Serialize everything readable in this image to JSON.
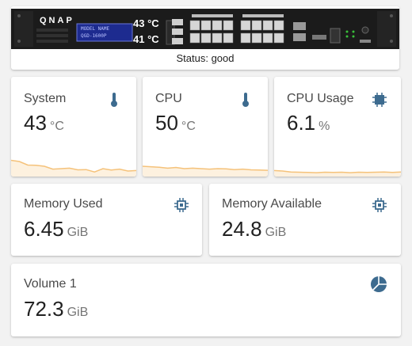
{
  "device": {
    "brand": "QNAP",
    "model_line1": "MODEL NAME",
    "model_line2": "QGD-1600P",
    "temp1": "43 °C",
    "temp2": "41 °C",
    "status": "Status: good"
  },
  "cards": {
    "system": {
      "title": "System",
      "value": "43",
      "unit": "°C",
      "icon": "thermometer-icon",
      "spark": [
        0.55,
        0.5,
        0.35,
        0.34,
        0.3,
        0.18,
        0.2,
        0.22,
        0.15,
        0.16,
        0.06,
        0.2,
        0.14,
        0.18,
        0.1,
        0.12
      ]
    },
    "cpu": {
      "title": "CPU",
      "value": "50",
      "unit": "°C",
      "icon": "thermometer-icon",
      "spark": [
        0.3,
        0.28,
        0.26,
        0.22,
        0.25,
        0.2,
        0.22,
        0.2,
        0.18,
        0.2,
        0.19,
        0.16,
        0.18,
        0.15,
        0.14,
        0.13
      ]
    },
    "cpu_usage": {
      "title": "CPU Usage",
      "value": "6.1",
      "unit": "%",
      "icon": "chip-icon",
      "spark": [
        0.12,
        0.1,
        0.06,
        0.05,
        0.04,
        0.03,
        0.05,
        0.04,
        0.05,
        0.03,
        0.05,
        0.04,
        0.05,
        0.06,
        0.04,
        0.06
      ]
    },
    "memory_used": {
      "title": "Memory Used",
      "value": "6.45",
      "unit": "GiB",
      "icon": "chip-icon"
    },
    "memory_available": {
      "title": "Memory Available",
      "value": "24.8",
      "unit": "GiB",
      "icon": "chip-icon"
    },
    "volume1": {
      "title": "Volume 1",
      "value": "72.3",
      "unit": "GiB",
      "icon": "pie-chart-icon"
    }
  },
  "colors": {
    "accent": "#3d6b8f",
    "spark_line": "#f5c27a",
    "spark_fill": "#fdf1df"
  }
}
